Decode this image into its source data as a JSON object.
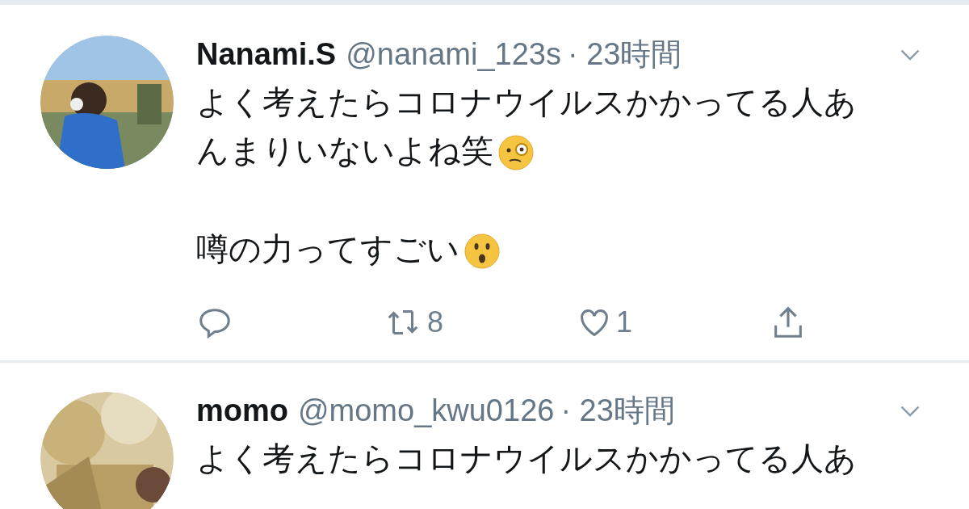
{
  "tweets": [
    {
      "avatar": {
        "kind": "picture"
      },
      "name": "Nanami.S",
      "handle": "@nanami_123s",
      "time": "· 23時間",
      "paragraphs": [
        {
          "text": "よく考えたらコロナウイルスかかってる人あんまりいないよね笑",
          "kind": "monocle"
        },
        {
          "text": "噂の力ってすごい",
          "kind": "surprised"
        }
      ],
      "actions": {
        "retweets": "8",
        "likes": "1"
      }
    },
    {
      "avatar": {
        "kind": "picture"
      },
      "name": "momo",
      "handle": "@momo_kwu0126",
      "time": "· 23時間",
      "paragraphs": [
        {
          "text": "よく考えたらコロナウイルスかかってる人あ",
          "kind": "plain"
        }
      ]
    }
  ]
}
